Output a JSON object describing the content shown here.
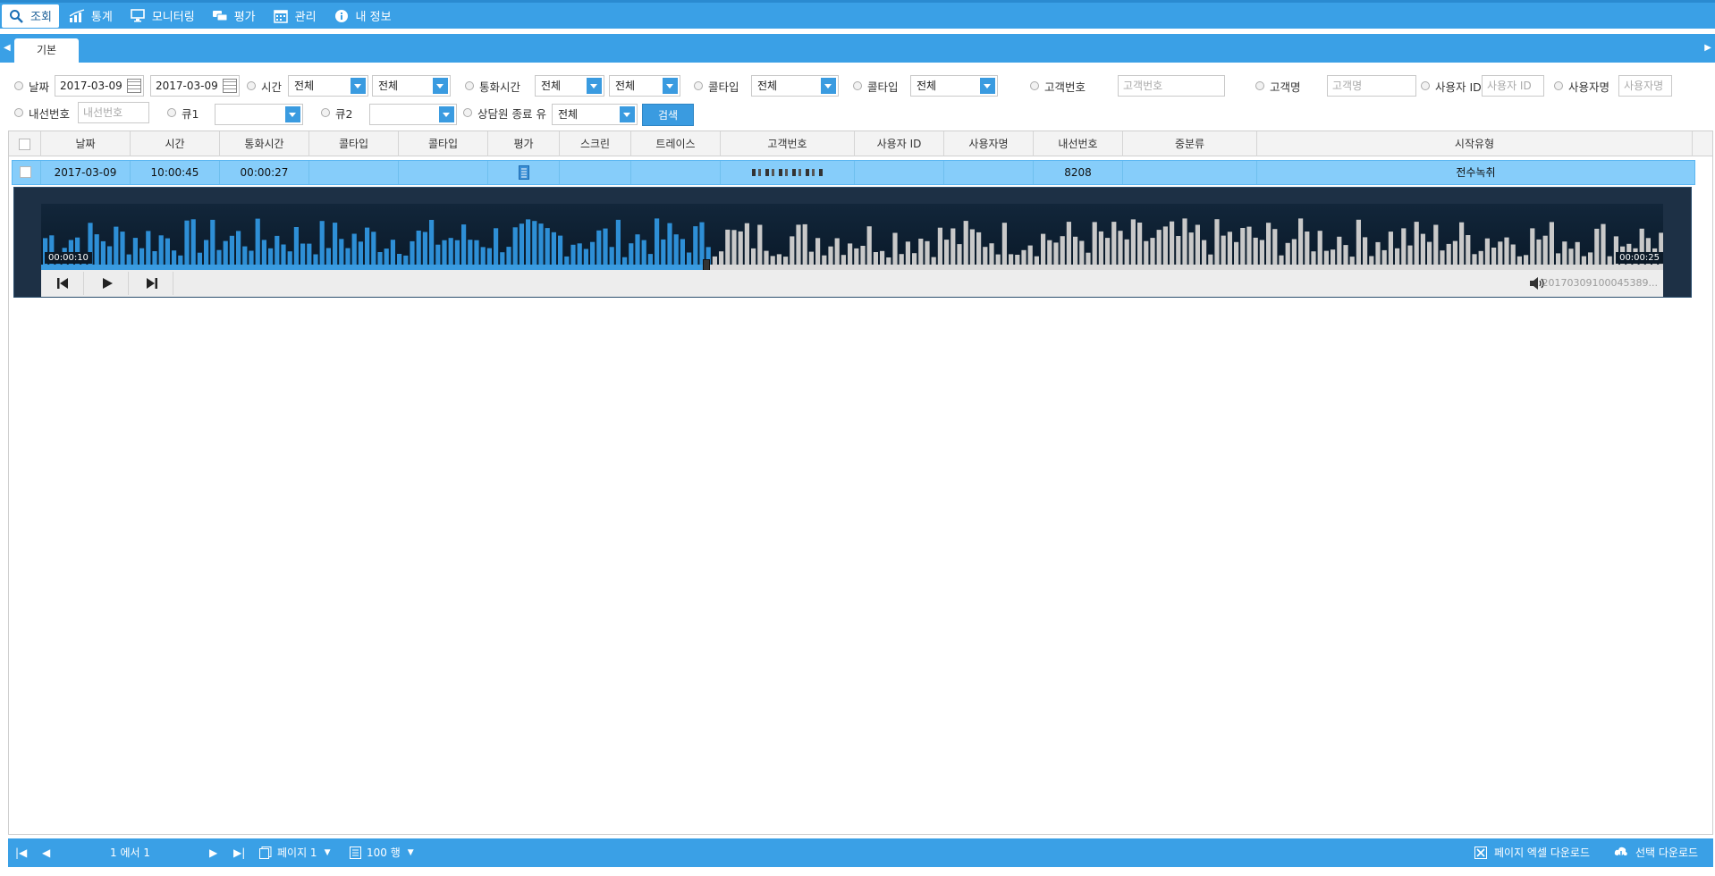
{
  "menu": {
    "items": [
      {
        "label": "조회",
        "icon": "search-icon"
      },
      {
        "label": "통계",
        "icon": "chart-icon"
      },
      {
        "label": "모니터링",
        "icon": "monitor-icon"
      },
      {
        "label": "평가",
        "icon": "chat-icon"
      },
      {
        "label": "관리",
        "icon": "calendar-icon"
      },
      {
        "label": "내 정보",
        "icon": "info-icon"
      }
    ]
  },
  "tabs": {
    "active": "기본"
  },
  "filters": {
    "date_label": "날짜",
    "date_from": "2017-03-09",
    "date_to": "2017-03-09",
    "time_label": "시간",
    "time_from": "전체",
    "time_to": "전체",
    "duration_label": "통화시간",
    "duration_from": "전체",
    "duration_to": "전체",
    "calltype1_label": "콜타입",
    "calltype1_value": "전체",
    "calltype2_label": "콜타입",
    "calltype2_value": "전체",
    "customer_no_label": "고객번호",
    "customer_no_placeholder": "고객번호",
    "customer_name_label": "고객명",
    "customer_name_placeholder": "고객명",
    "user_id_label": "사용자 ID",
    "user_id_placeholder": "사용자 ID",
    "user_name_label": "사용자명",
    "user_name_placeholder": "사용자명",
    "extension_label": "내선번호",
    "extension_placeholder": "내선번호",
    "queue1_label": "큐1",
    "queue1_value": "",
    "queue2_label": "큐2",
    "queue2_value": "",
    "end_type_label": "상담원 종료 유",
    "end_type_value": "전체",
    "search_button": "검색"
  },
  "grid": {
    "columns": [
      "날짜",
      "시간",
      "통화시간",
      "콜타입",
      "콜타입",
      "평가",
      "스크린",
      "트레이스",
      "고객번호",
      "사용자 ID",
      "사용자명",
      "내선번호",
      "중분류",
      "시작유형"
    ],
    "rows": [
      {
        "date": "2017-03-09",
        "time": "10:00:45",
        "duration": "00:00:27",
        "calltype1": "",
        "calltype2": "",
        "eval_icon": "document-icon",
        "screen": "",
        "trace": "",
        "customer_no": "",
        "user_id": "",
        "user_name": "",
        "extension": "8208",
        "category": "",
        "start_type": "전수녹취"
      }
    ]
  },
  "player": {
    "current_time": "00:00:10",
    "end_time": "00:00:25",
    "progress_fraction": 0.41,
    "filename": "20170309100045389...",
    "colors": {
      "played": "#2e8fd6",
      "unplayed": "#c9c9c9"
    }
  },
  "footer": {
    "page_info": "1 에서 1",
    "page_label": "페이지 1",
    "rows_label": "100 행",
    "excel_download": "페이지 엑셀 다운로드",
    "select_download": "선택 다운로드"
  }
}
